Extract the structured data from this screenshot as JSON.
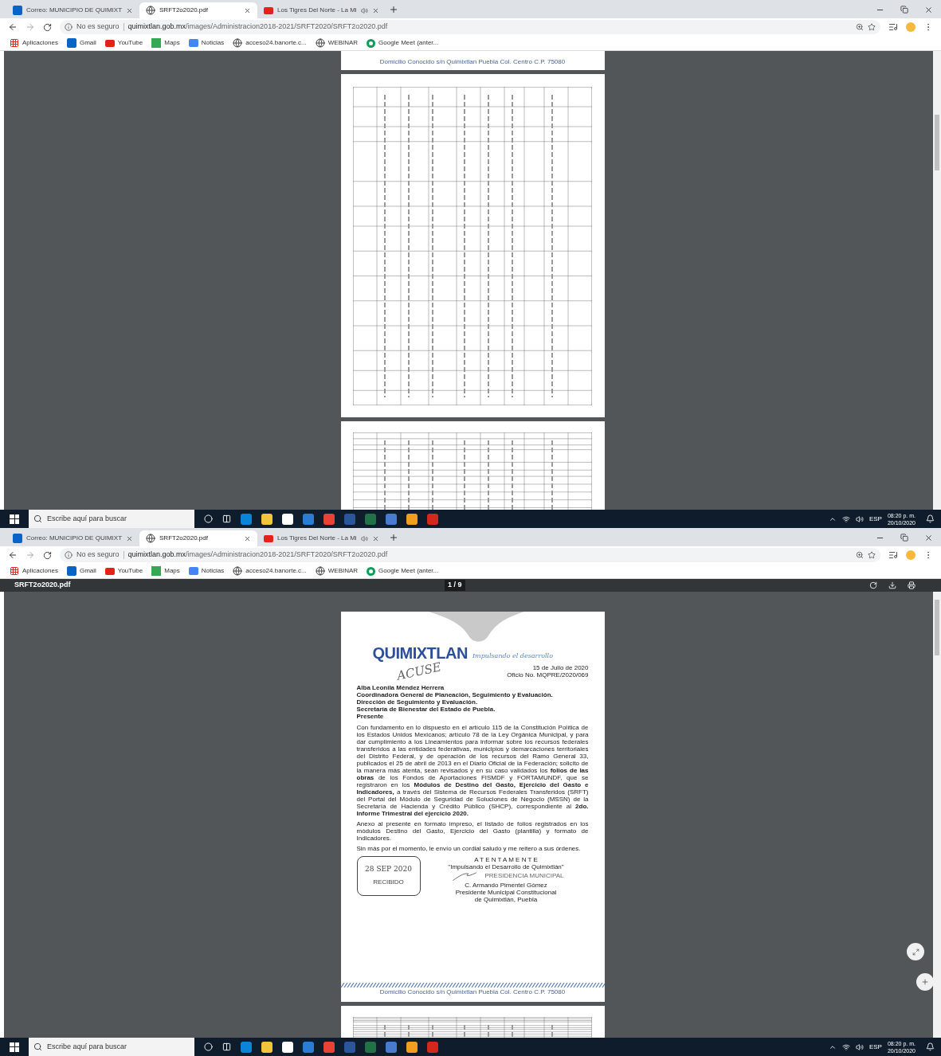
{
  "screens": [
    {
      "tabs": [
        {
          "label": "Correo: MUNICIPIO DE QUIMIXT",
          "kind": "mail",
          "selected": false,
          "audio": false
        },
        {
          "label": "SRFT2o2020.pdf",
          "kind": "globe",
          "selected": true,
          "audio": false
        },
        {
          "label": "Los Tigres Del Norte - La Mi",
          "kind": "video",
          "selected": false,
          "audio": true
        }
      ],
      "address": {
        "security": "No es seguro",
        "domain": "quimixtlan.gob.mx",
        "path": "/images/Administracion2018-2021/SRFT2020/SRFT2o2020.pdf"
      },
      "bookmarks": [
        {
          "label": "Aplicaciones",
          "kind": "apps"
        },
        {
          "label": "Gmail",
          "kind": "mail"
        },
        {
          "label": "YouTube",
          "kind": "video"
        },
        {
          "label": "Maps",
          "kind": "map"
        },
        {
          "label": "Noticias",
          "kind": "news"
        },
        {
          "label": "acceso24.banorte.c...",
          "kind": "globe"
        },
        {
          "label": "WEBINAR",
          "kind": "globe"
        },
        {
          "label": "Google Meet (anter...",
          "kind": "meet"
        }
      ],
      "viewer": {
        "pages": [
          {
            "kind": "footer",
            "footer": "Domicilio Conocido s/n Quimixtlan Puebla Col. Centro C.P. 75080"
          },
          {
            "kind": "table"
          },
          {
            "kind": "table-partial"
          }
        ]
      },
      "taskbar": {
        "search": "Escribe aquí para buscar",
        "language": "ESP",
        "time": "08:20 p. m.",
        "date": "20/10/2020"
      }
    },
    {
      "tabs": [
        {
          "label": "Correo: MUNICIPIO DE QUIMIXT",
          "kind": "mail",
          "selected": false,
          "audio": false
        },
        {
          "label": "SRFT2o2020.pdf",
          "kind": "globe",
          "selected": true,
          "audio": false
        },
        {
          "label": "Los Tigres Del Norte - La Mi",
          "kind": "video",
          "selected": false,
          "audio": true
        }
      ],
      "address": {
        "security": "No es seguro",
        "domain": "quimixtlan.gob.mx",
        "path": "/images/Administracion2018-2021/SRFT2020/SRFT2o2020.pdf"
      },
      "bookmarks": [
        {
          "label": "Aplicaciones",
          "kind": "apps"
        },
        {
          "label": "Gmail",
          "kind": "mail"
        },
        {
          "label": "YouTube",
          "kind": "video"
        },
        {
          "label": "Maps",
          "kind": "map"
        },
        {
          "label": "Noticias",
          "kind": "news"
        },
        {
          "label": "acceso24.banorte.c...",
          "kind": "globe"
        },
        {
          "label": "WEBINAR",
          "kind": "globe"
        },
        {
          "label": "Google Meet (anter...",
          "kind": "meet"
        }
      ],
      "viewer": {
        "toolbar": {
          "filename": "SRFT2o2020.pdf",
          "page": "1 / 9"
        },
        "pages": [
          {
            "kind": "letter",
            "logo": "QUIMIXTLAN",
            "slogan": "Impulsando el desarrollo",
            "handwriting": "ACUSE",
            "date": "15 de Julio de 2020",
            "office": "Oficio No. MQPRE/2020/069",
            "addressee": [
              "Alba Leonila Méndez Herrera",
              "Coordinadora General de Planeación, Seguimiento y Evaluación.",
              "Dirección de Seguimiento y Evaluación.",
              "Secretaría de Bienestar del Estado de Puebla.",
              "Presente"
            ],
            "paragraphs": [
              "Con fundamento en lo dispuesto en el artículo 115 de la Constitución Política de los Estados Unidos Mexicanos; artículo 78 de la Ley Orgánica Municipal, y para dar cumplimiento a los Lineamientos para informar sobre los recursos federales transferidos a las entidades federativas, municipios y demarcaciones territoriales del Distrito Federal, y de operación de los recursos del Ramo General 33, publicados el 25 de abril de 2013 en el Diario Oficial de la Federación; solicito de la manera más atenta, sean revisados y en su caso validados los **folios de las obras** de los Fondos de Aportaciones FISMDF y FORTAMUNDF, que se registraron en los **Módulos de Destino del Gasto, Ejercicio del Gasto e Indicadores,** a través del Sistema de Recursos Federales Transferidos (SRFT) del Portal del Módulo de Seguridad de Soluciones de Negocio (MSSN) de la Secretaría de Hacienda y Crédito Público (SHCP), correspondiente al **2do. Informe Trimestral del ejercicio 2020.**",
              "Anexo al presente en formato impreso, el listado de folios registrados en los módulos Destino del Gasto, Ejercicio del Gasto (plantilla) y formato de Indicadores.",
              "Sin más por el momento, le envío un cordial saludo y me reitero a sus órdenes."
            ],
            "closing": "A T E N T A M E N T E",
            "motto": "\"Impulsando el Desarrollo de Quimixtlán\"",
            "stamp_date": "28 SEP 2020",
            "stamp_label": "RECIBIDO",
            "seal": "PRESIDENCIA MUNICIPAL",
            "signer": [
              "C. Armando Pimentel Gómez",
              "Presidente Municipal Constitucional",
              "de Quimixtlán, Puebla"
            ],
            "footer": "Domicilio Conocido s/n Quimixtlan Puebla Col. Centro C.P. 75080"
          },
          {
            "kind": "table-partial"
          }
        ]
      },
      "taskbar": {
        "search": "Escribe aquí para buscar",
        "language": "ESP",
        "time": "08:20 p. m.",
        "date": "20/10/2020"
      }
    }
  ]
}
